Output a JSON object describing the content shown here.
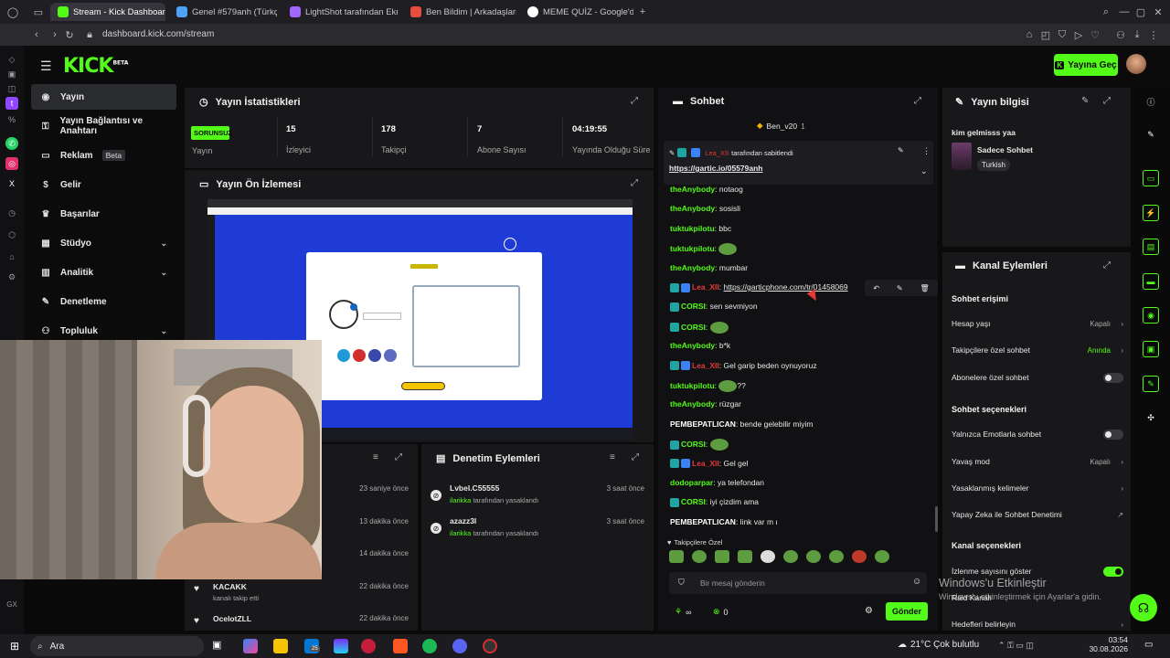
{
  "browser": {
    "tabs": [
      {
        "title": "Stream - Kick Dashboard",
        "active": true,
        "favicon_color": "#53fc18"
      },
      {
        "title": "Genel #579anh (Türkçe) - ",
        "active": false,
        "favicon_color": "#4fa3f7"
      },
      {
        "title": "LightShot tarafından Ekran",
        "active": false,
        "favicon_color": "#a066ff"
      },
      {
        "title": "Ben Bildim | Arkadaşlarınla",
        "active": false,
        "favicon_color": "#e74c3c"
      },
      {
        "title": "MEME QUİZ - Google'da A",
        "active": false,
        "favicon_color": "#ffffff"
      }
    ],
    "url": "dashboard.kick.com/stream"
  },
  "header": {
    "logo": "KICK",
    "logo_badge": "BETA",
    "go_live": "Yayına Geç",
    "accent_color": "#53fc18"
  },
  "sidebar": {
    "items": [
      {
        "label": "Yayın",
        "icon": "broadcast-icon",
        "active": true
      },
      {
        "label": "Yayın Bağlantısı ve Anahtarı",
        "icon": "key-icon"
      },
      {
        "label": "Reklam",
        "icon": "ad-icon",
        "badge": "Beta"
      },
      {
        "label": "Gelir",
        "icon": "money-icon"
      },
      {
        "label": "Başarılar",
        "icon": "trophy-icon"
      },
      {
        "label": "Stüdyo",
        "icon": "studio-icon",
        "expandable": true
      },
      {
        "label": "Analitik",
        "icon": "chart-icon",
        "expandable": true
      },
      {
        "label": "Denetleme",
        "icon": "wrench-icon"
      },
      {
        "label": "Topluluk",
        "icon": "people-icon",
        "expandable": true
      }
    ]
  },
  "stats": {
    "title": "Yayın İstatistikleri",
    "status_badge": "SORUNSUZ",
    "items": [
      {
        "value": "",
        "label": "Yayın"
      },
      {
        "value": "15",
        "label": "İzleyici"
      },
      {
        "value": "178",
        "label": "Takipçi"
      },
      {
        "value": "7",
        "label": "Abone Sayısı"
      },
      {
        "value": "04:19:55",
        "label": "Yayında Olduğu Süre"
      }
    ]
  },
  "preview": {
    "title": "Yayın Ön İzlemesi"
  },
  "activity": {
    "items": [
      {
        "user": "",
        "text": "",
        "time": "23 saniye önce"
      },
      {
        "user": "",
        "text": "",
        "time": "13 dakika önce"
      },
      {
        "user": "",
        "text": "",
        "time": "14 dakika önce"
      },
      {
        "user": "KACAKK",
        "text": "kanalı takip etti",
        "time": "22 dakika önce"
      },
      {
        "user": "OcelotZLL",
        "text": "",
        "time": "22 dakika önce"
      }
    ]
  },
  "moderation": {
    "title": "Denetim Eylemleri",
    "items": [
      {
        "user": "Lvbel.C55555",
        "by": "ilarikka",
        "action": "tarafından yasaklandı",
        "time": "3 saat önce"
      },
      {
        "user": "azazz3l",
        "by": "ilarikka",
        "action": "tarafından yasaklandı",
        "time": "3 saat önce"
      }
    ]
  },
  "chat": {
    "title": "Sohbet",
    "top_gifter": "Ben_v20",
    "top_gifter_count": "1",
    "pinned": {
      "user": "Lea_XII",
      "suffix": "tarafından sabitlendi",
      "link": "https://gartic.io/05579anh"
    },
    "messages": [
      {
        "user": "theAnybody",
        "color": "#53fc18",
        "text": "notaog"
      },
      {
        "user": "theAnybody",
        "color": "#53fc18",
        "text": "sosisli"
      },
      {
        "user": "tuktukpilotu",
        "color": "#53fc18",
        "text": "bbc"
      },
      {
        "user": "tuktukpilotu",
        "color": "#53fc18",
        "text": "",
        "emote": true
      },
      {
        "user": "theAnybody",
        "color": "#53fc18",
        "text": "mumbar"
      },
      {
        "user": "Lea_XII",
        "color": "#e53935",
        "text": "https://garticphone.com/tr/01458069",
        "link": true,
        "badges": true
      },
      {
        "user": "CORSI",
        "color": "#53fc18",
        "text": "sen sevmiyon",
        "badge": true
      },
      {
        "user": "CORSI",
        "color": "#53fc18",
        "text": "",
        "emote": true,
        "badge": true
      },
      {
        "user": "theAnybody",
        "color": "#53fc18",
        "text": "b*k"
      },
      {
        "user": "Lea_XII",
        "color": "#e53935",
        "text": "Gel garip beden oynuyoruz",
        "badges": true
      },
      {
        "user": "tuktukpilotu",
        "color": "#53fc18",
        "text": "??",
        "emote": true
      },
      {
        "user": "theAnybody",
        "color": "#53fc18",
        "text": "rüzgar"
      },
      {
        "user": "PEMBEPATLICAN",
        "color": "#ffffff",
        "text": "bende gelebilir miyim"
      },
      {
        "user": "CORSI",
        "color": "#53fc18",
        "text": "",
        "emote": true,
        "badge": true
      },
      {
        "user": "Lea_XII",
        "color": "#e53935",
        "text": "Gel gel",
        "badges": true
      },
      {
        "user": "dodoparpar",
        "color": "#53fc18",
        "text": "ya telefondan"
      },
      {
        "user": "CORSI",
        "color": "#53fc18",
        "text": "iyi çizdim ama",
        "badge": true
      },
      {
        "user": "PEMBEPATLICAN",
        "color": "#ffffff",
        "text": "link var m ı"
      }
    ],
    "followers_only_label": "Takipçilere Özel",
    "input_placeholder": "Bir mesaj gönderin",
    "send": "Gönder",
    "count_a": "∞",
    "count_b": "0"
  },
  "stream_info": {
    "title": "Yayın bilgisi",
    "stream_title": "kim gelmisss yaa",
    "category": "Sadece Sohbet",
    "tag": "Turkish"
  },
  "channel_actions": {
    "title": "Kanal Eylemleri",
    "sections": [
      {
        "heading": "Sohbet erişimi",
        "rows": [
          {
            "label": "Hesap yaşı",
            "value": "Kapalı",
            "type": "arrow"
          },
          {
            "label": "Takipçilere özel sohbet",
            "value": "Anında",
            "type": "arrow",
            "green": true
          },
          {
            "label": "Abonelere özel sohbet",
            "value": "",
            "type": "toggle"
          }
        ]
      },
      {
        "heading": "Sohbet seçenekleri",
        "rows": [
          {
            "label": "Yalnızca Emotlarla sohbet",
            "value": "",
            "type": "toggle"
          },
          {
            "label": "Yavaş mod",
            "value": "Kapalı",
            "type": "arrow"
          },
          {
            "label": "Yasaklanmış kelimeler",
            "value": "",
            "type": "arrow"
          },
          {
            "label": "Yapay Zeka ile Sohbet Denetimi",
            "value": "",
            "type": "external"
          }
        ]
      },
      {
        "heading": "Kanal seçenekleri",
        "rows": [
          {
            "label": "İzlenme sayısını göster",
            "value": "",
            "type": "toggle-on"
          },
          {
            "label": "Raid Kanalı",
            "value": "",
            "type": "none"
          },
          {
            "label": "Hedefleri belirleyin",
            "value": "",
            "type": "arrow"
          }
        ]
      }
    ]
  },
  "watermark": {
    "line1": "Windows'u Etkinleştir",
    "line2": "Windows'u etkinleştirmek için Ayarlar'a gidin."
  },
  "taskbar": {
    "search": "Ara",
    "weather": "21°C Çok bulutlu",
    "time": "03:54",
    "date": "30.08.2026",
    "badge": "25"
  }
}
